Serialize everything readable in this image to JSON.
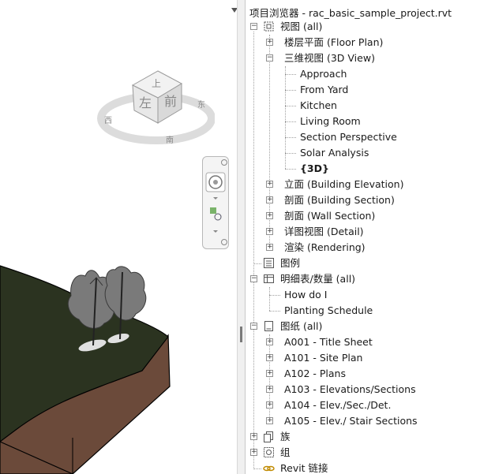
{
  "browser": {
    "title": "项目浏览器 - rac_basic_sample_project.rvt",
    "views": {
      "label": "视图 (all)",
      "floor_plan": "楼层平面 (Floor Plan)",
      "view3d": "三维视图 (3D View)",
      "views3d": [
        "Approach",
        "From Yard",
        "Kitchen",
        "Living Room",
        "Section Perspective",
        "Solar Analysis",
        "{3D}"
      ],
      "elevation": "立面 (Building Elevation)",
      "building_section": "剖面 (Building Section)",
      "wall_section": "剖面 (Wall Section)",
      "detail": "详图视图 (Detail)",
      "rendering": "渲染 (Rendering)"
    },
    "legends": "图例",
    "schedules": {
      "label": "明细表/数量 (all)",
      "items": [
        "How do I",
        "Planting Schedule"
      ]
    },
    "sheets": {
      "label": "图纸 (all)",
      "items": [
        "A001 - Title Sheet",
        "A101 - Site Plan",
        "A102 - Plans",
        "A103 - Elevations/Sections",
        "A104 - Elev./Sec./Det.",
        "A105 - Elev./ Stair Sections"
      ]
    },
    "families": "族",
    "groups": "组",
    "links": "Revit 链接"
  },
  "viewcube": {
    "top": "上",
    "left": "左",
    "front": "前",
    "south": "南",
    "east": "东",
    "west": "西"
  },
  "colors": {
    "terrain": "#2b3320",
    "soil": "#6b4a3a",
    "tree": "#7a7a7a"
  }
}
